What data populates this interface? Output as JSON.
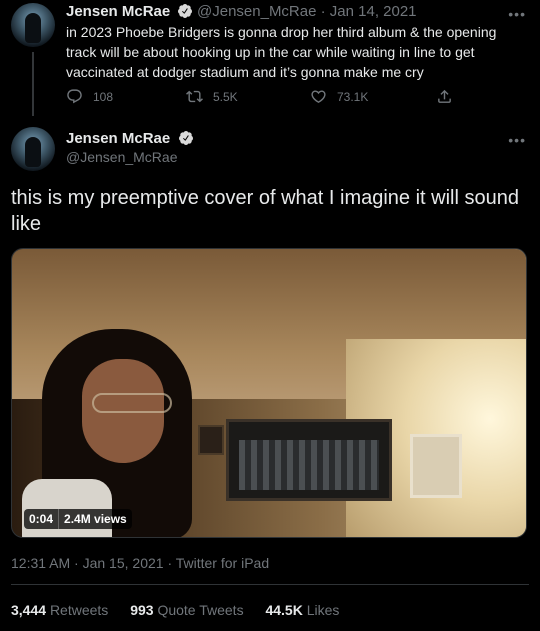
{
  "colors": {
    "background": "#000000",
    "text": "#e7e9ea",
    "muted": "#71767b",
    "verified": "#d9d9d9",
    "divider": "#2f3336"
  },
  "quoted_tweet": {
    "name": "Jensen McRae",
    "handle_date": "@Jensen_McRae · Jan 14, 2021",
    "text": "in 2023 Phoebe Bridgers is gonna drop her third album & the opening track will be about hooking up in the car while waiting in line to get vaccinated at dodger stadium and it’s gonna make me cry",
    "more_icon": "more-icon",
    "actions": {
      "replies": "108",
      "retweets": "5.5K",
      "likes": "73.1K"
    }
  },
  "main_tweet": {
    "name": "Jensen McRae",
    "handle": "@Jensen_McRae",
    "text": "this is my preemptive cover of what I imagine it will sound like",
    "video": {
      "time": "0:04",
      "views": "2.4M views"
    },
    "meta": "12:31 AM · Jan 15, 2021 · Twitter for iPad",
    "stats": [
      {
        "count": "3,444",
        "label": "Retweets"
      },
      {
        "count": "993",
        "label": "Quote Tweets"
      },
      {
        "count": "44.5K",
        "label": "Likes"
      }
    ]
  }
}
